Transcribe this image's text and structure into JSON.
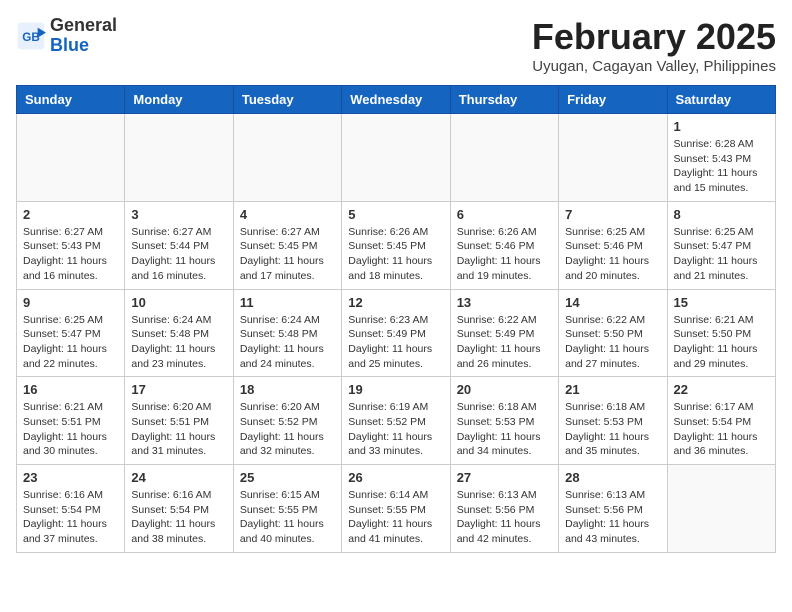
{
  "header": {
    "logo_general": "General",
    "logo_blue": "Blue",
    "title": "February 2025",
    "subtitle": "Uyugan, Cagayan Valley, Philippines"
  },
  "weekdays": [
    "Sunday",
    "Monday",
    "Tuesday",
    "Wednesday",
    "Thursday",
    "Friday",
    "Saturday"
  ],
  "weeks": [
    [
      {
        "day": "",
        "info": ""
      },
      {
        "day": "",
        "info": ""
      },
      {
        "day": "",
        "info": ""
      },
      {
        "day": "",
        "info": ""
      },
      {
        "day": "",
        "info": ""
      },
      {
        "day": "",
        "info": ""
      },
      {
        "day": "1",
        "info": "Sunrise: 6:28 AM\nSunset: 5:43 PM\nDaylight: 11 hours and 15 minutes."
      }
    ],
    [
      {
        "day": "2",
        "info": "Sunrise: 6:27 AM\nSunset: 5:43 PM\nDaylight: 11 hours and 16 minutes."
      },
      {
        "day": "3",
        "info": "Sunrise: 6:27 AM\nSunset: 5:44 PM\nDaylight: 11 hours and 16 minutes."
      },
      {
        "day": "4",
        "info": "Sunrise: 6:27 AM\nSunset: 5:45 PM\nDaylight: 11 hours and 17 minutes."
      },
      {
        "day": "5",
        "info": "Sunrise: 6:26 AM\nSunset: 5:45 PM\nDaylight: 11 hours and 18 minutes."
      },
      {
        "day": "6",
        "info": "Sunrise: 6:26 AM\nSunset: 5:46 PM\nDaylight: 11 hours and 19 minutes."
      },
      {
        "day": "7",
        "info": "Sunrise: 6:25 AM\nSunset: 5:46 PM\nDaylight: 11 hours and 20 minutes."
      },
      {
        "day": "8",
        "info": "Sunrise: 6:25 AM\nSunset: 5:47 PM\nDaylight: 11 hours and 21 minutes."
      }
    ],
    [
      {
        "day": "9",
        "info": "Sunrise: 6:25 AM\nSunset: 5:47 PM\nDaylight: 11 hours and 22 minutes."
      },
      {
        "day": "10",
        "info": "Sunrise: 6:24 AM\nSunset: 5:48 PM\nDaylight: 11 hours and 23 minutes."
      },
      {
        "day": "11",
        "info": "Sunrise: 6:24 AM\nSunset: 5:48 PM\nDaylight: 11 hours and 24 minutes."
      },
      {
        "day": "12",
        "info": "Sunrise: 6:23 AM\nSunset: 5:49 PM\nDaylight: 11 hours and 25 minutes."
      },
      {
        "day": "13",
        "info": "Sunrise: 6:22 AM\nSunset: 5:49 PM\nDaylight: 11 hours and 26 minutes."
      },
      {
        "day": "14",
        "info": "Sunrise: 6:22 AM\nSunset: 5:50 PM\nDaylight: 11 hours and 27 minutes."
      },
      {
        "day": "15",
        "info": "Sunrise: 6:21 AM\nSunset: 5:50 PM\nDaylight: 11 hours and 29 minutes."
      }
    ],
    [
      {
        "day": "16",
        "info": "Sunrise: 6:21 AM\nSunset: 5:51 PM\nDaylight: 11 hours and 30 minutes."
      },
      {
        "day": "17",
        "info": "Sunrise: 6:20 AM\nSunset: 5:51 PM\nDaylight: 11 hours and 31 minutes."
      },
      {
        "day": "18",
        "info": "Sunrise: 6:20 AM\nSunset: 5:52 PM\nDaylight: 11 hours and 32 minutes."
      },
      {
        "day": "19",
        "info": "Sunrise: 6:19 AM\nSunset: 5:52 PM\nDaylight: 11 hours and 33 minutes."
      },
      {
        "day": "20",
        "info": "Sunrise: 6:18 AM\nSunset: 5:53 PM\nDaylight: 11 hours and 34 minutes."
      },
      {
        "day": "21",
        "info": "Sunrise: 6:18 AM\nSunset: 5:53 PM\nDaylight: 11 hours and 35 minutes."
      },
      {
        "day": "22",
        "info": "Sunrise: 6:17 AM\nSunset: 5:54 PM\nDaylight: 11 hours and 36 minutes."
      }
    ],
    [
      {
        "day": "23",
        "info": "Sunrise: 6:16 AM\nSunset: 5:54 PM\nDaylight: 11 hours and 37 minutes."
      },
      {
        "day": "24",
        "info": "Sunrise: 6:16 AM\nSunset: 5:54 PM\nDaylight: 11 hours and 38 minutes."
      },
      {
        "day": "25",
        "info": "Sunrise: 6:15 AM\nSunset: 5:55 PM\nDaylight: 11 hours and 40 minutes."
      },
      {
        "day": "26",
        "info": "Sunrise: 6:14 AM\nSunset: 5:55 PM\nDaylight: 11 hours and 41 minutes."
      },
      {
        "day": "27",
        "info": "Sunrise: 6:13 AM\nSunset: 5:56 PM\nDaylight: 11 hours and 42 minutes."
      },
      {
        "day": "28",
        "info": "Sunrise: 6:13 AM\nSunset: 5:56 PM\nDaylight: 11 hours and 43 minutes."
      },
      {
        "day": "",
        "info": ""
      }
    ]
  ]
}
